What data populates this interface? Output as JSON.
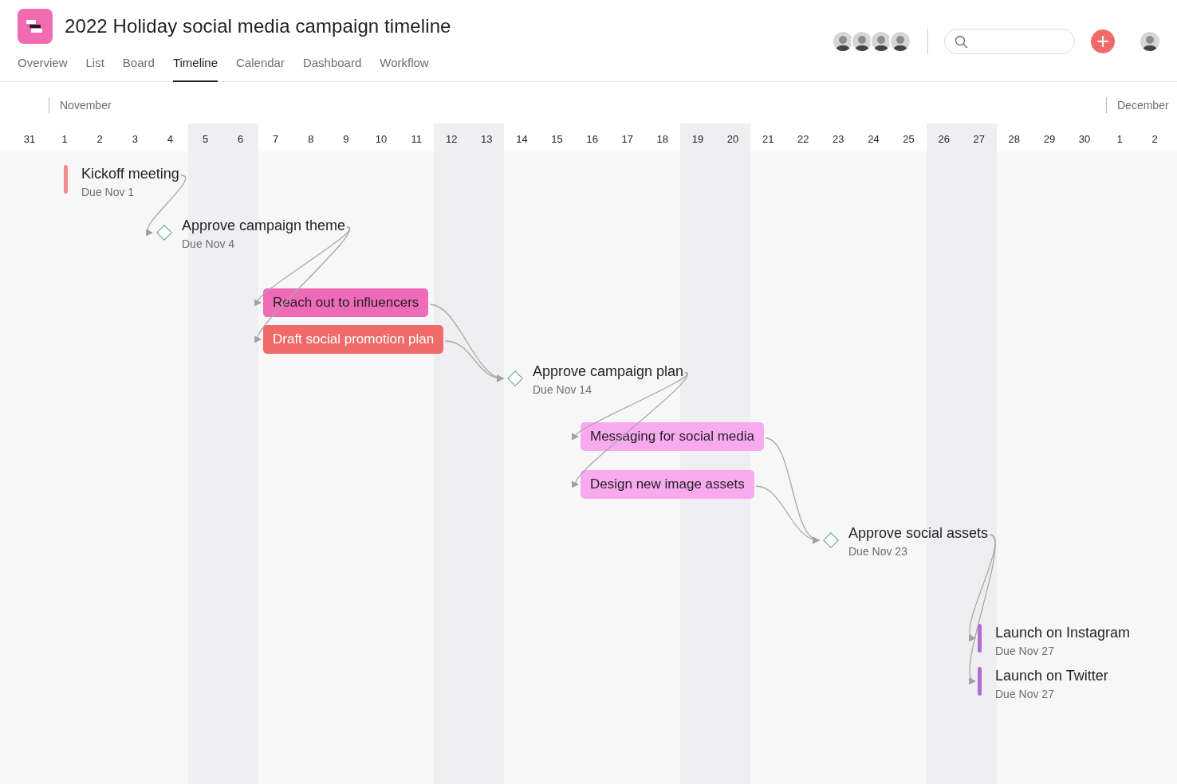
{
  "project": {
    "title": "2022 Holiday social media campaign timeline"
  },
  "tabs": [
    {
      "label": "Overview",
      "selected": false
    },
    {
      "label": "List",
      "selected": false
    },
    {
      "label": "Board",
      "selected": false
    },
    {
      "label": "Timeline",
      "selected": true
    },
    {
      "label": "Calendar",
      "selected": false
    },
    {
      "label": "Dashboard",
      "selected": false
    },
    {
      "label": "Workflow",
      "selected": false
    }
  ],
  "timeline": {
    "months": [
      {
        "label": "November"
      },
      {
        "label": "December"
      }
    ],
    "days": [
      {
        "label": "31",
        "weekend": false
      },
      {
        "label": "1",
        "weekend": false
      },
      {
        "label": "2",
        "weekend": false
      },
      {
        "label": "3",
        "weekend": false
      },
      {
        "label": "4",
        "weekend": false
      },
      {
        "label": "5",
        "weekend": true
      },
      {
        "label": "6",
        "weekend": true
      },
      {
        "label": "7",
        "weekend": false
      },
      {
        "label": "8",
        "weekend": false
      },
      {
        "label": "9",
        "weekend": false
      },
      {
        "label": "10",
        "weekend": false
      },
      {
        "label": "11",
        "weekend": false
      },
      {
        "label": "12",
        "weekend": true
      },
      {
        "label": "13",
        "weekend": true
      },
      {
        "label": "14",
        "weekend": false
      },
      {
        "label": "15",
        "weekend": false
      },
      {
        "label": "16",
        "weekend": false
      },
      {
        "label": "17",
        "weekend": false
      },
      {
        "label": "18",
        "weekend": false
      },
      {
        "label": "19",
        "weekend": true
      },
      {
        "label": "20",
        "weekend": true
      },
      {
        "label": "21",
        "weekend": false
      },
      {
        "label": "22",
        "weekend": false
      },
      {
        "label": "23",
        "weekend": false
      },
      {
        "label": "24",
        "weekend": false
      },
      {
        "label": "25",
        "weekend": false
      },
      {
        "label": "26",
        "weekend": true
      },
      {
        "label": "27",
        "weekend": true
      },
      {
        "label": "28",
        "weekend": false
      },
      {
        "label": "29",
        "weekend": false
      },
      {
        "label": "30",
        "weekend": false
      },
      {
        "label": "1",
        "weekend": false
      },
      {
        "label": "2",
        "weekend": false
      }
    ],
    "items": [
      {
        "kind": "task",
        "title": "Kickoff meeting",
        "due": "Due Nov 1",
        "color": "#f28b8b"
      },
      {
        "kind": "milestone",
        "title": "Approve campaign theme",
        "due": "Due Nov 4"
      },
      {
        "kind": "bar",
        "title": "Reach out to influencers",
        "color": "#f06bb7"
      },
      {
        "kind": "bar",
        "title": "Draft social promotion plan",
        "color": "#f06a6a"
      },
      {
        "kind": "milestone",
        "title": "Approve campaign plan",
        "due": "Due Nov 14"
      },
      {
        "kind": "bar",
        "title": "Messaging for social media",
        "color": "#f9aaef"
      },
      {
        "kind": "bar",
        "title": "Design new image assets",
        "color": "#f9aaef"
      },
      {
        "kind": "milestone",
        "title": "Approve social assets",
        "due": "Due Nov 23"
      },
      {
        "kind": "task",
        "title": "Launch on Instagram",
        "due": "Due Nov 27",
        "color": "#b36bd4"
      },
      {
        "kind": "task",
        "title": "Launch on Twitter",
        "due": "Due Nov 27",
        "color": "#b36bd4"
      }
    ]
  }
}
